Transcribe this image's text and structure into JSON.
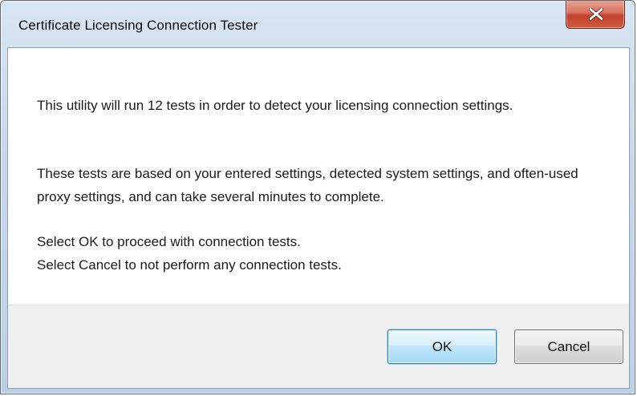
{
  "window": {
    "title": "Certificate Licensing Connection Tester",
    "close_icon": "close-icon"
  },
  "message": {
    "paragraph1": "This utility will run 12 tests in order to detect your licensing connection settings.",
    "paragraph2": "These tests are based on your entered settings, detected system settings, and often-used proxy settings, and can take several minutes to complete.",
    "paragraph3_line1": "Select OK to proceed with connection tests.",
    "paragraph3_line2": "Select Cancel to not perform any connection tests."
  },
  "buttons": {
    "ok_label": "OK",
    "cancel_label": "Cancel"
  },
  "colors": {
    "close_button": "#c7452f",
    "ok_border": "#3c7fb1",
    "footer_bg": "#f0f0f0"
  }
}
